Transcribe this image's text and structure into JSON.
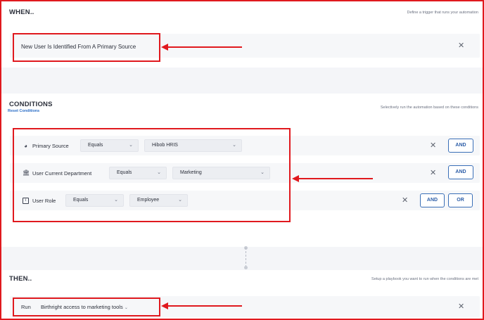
{
  "when": {
    "title": "WHEN..",
    "hint": "Define a trigger that runs your automation",
    "trigger": "New User Is Identified From A Primary Source"
  },
  "conditions": {
    "title": "CONDITIONS",
    "reset_label": "Reset Conditions",
    "hint": "Selectively run the automation based on these conditions",
    "rows": [
      {
        "icon": "primary-source-icon",
        "label": "Primary Source",
        "operator": "Equals",
        "value": "Hibob HRIS",
        "buttons": [
          "AND"
        ]
      },
      {
        "icon": "department-icon",
        "label": "User Current Department",
        "operator": "Equals",
        "value": "Marketing",
        "buttons": [
          "AND"
        ]
      },
      {
        "icon": "user-role-icon",
        "label": "User Role",
        "operator": "Equals",
        "value": "Employee",
        "buttons": [
          "AND",
          "OR"
        ]
      }
    ]
  },
  "then": {
    "title": "THEN..",
    "hint": "Setup a playbook you want to run when the conditions are met",
    "run_label": "Run",
    "playbook": "Birthright access to marketing tools"
  },
  "colors": {
    "annotation": "#e0191e",
    "button_border": "#3a6fb7",
    "link": "#2d6fc7"
  }
}
